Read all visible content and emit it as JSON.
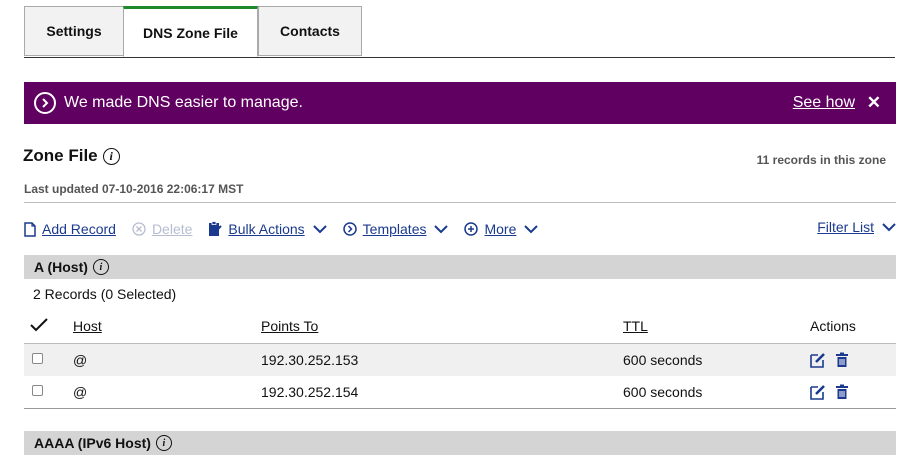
{
  "tabs": [
    "Settings",
    "DNS Zone File",
    "Contacts"
  ],
  "banner": {
    "message": "We made DNS easier to manage.",
    "link": "See how",
    "close": "✕",
    "bg_color": "#600060"
  },
  "zone": {
    "title": "Zone File",
    "record_count": "11 records in this zone",
    "last_updated": "Last updated 07-10-2016 22:06:17 MST"
  },
  "toolbar": {
    "add_record": "Add Record",
    "delete": "Delete",
    "bulk_actions": "Bulk Actions",
    "templates": "Templates",
    "more": "More",
    "filter_list": "Filter List"
  },
  "sections": {
    "a": {
      "title": "A (Host)",
      "records_summary": "2 Records (0 Selected)",
      "columns": [
        "Host",
        "Points To",
        "TTL",
        "Actions"
      ],
      "rows": [
        {
          "host": "@",
          "points_to": "192.30.252.153",
          "ttl": "600 seconds"
        },
        {
          "host": "@",
          "points_to": "192.30.252.154",
          "ttl": "600 seconds"
        }
      ]
    },
    "aaaa": {
      "title": "AAAA (IPv6 Host)"
    }
  },
  "accent_color": "#1b3a8e"
}
